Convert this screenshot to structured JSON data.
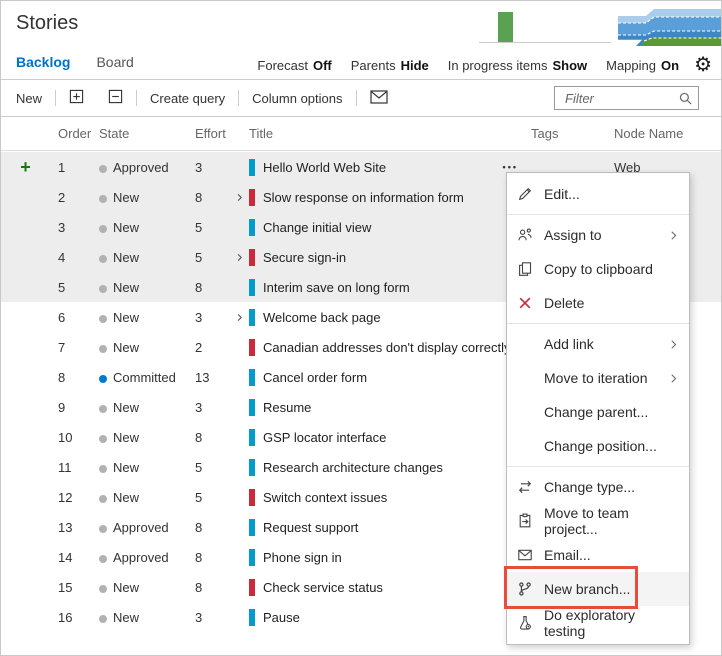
{
  "window": {
    "title": "Stories"
  },
  "tabs": [
    {
      "label": "Backlog",
      "active": true
    },
    {
      "label": "Board",
      "active": false
    }
  ],
  "view_toggles": [
    {
      "label": "Forecast",
      "value": "Off"
    },
    {
      "label": "Parents",
      "value": "Hide"
    },
    {
      "label": "In progress items",
      "value": "Show"
    },
    {
      "label": "Mapping",
      "value": "On"
    }
  ],
  "icons": {
    "gear": "⚙",
    "more_actions": "•••",
    "add_row": "+"
  },
  "toolbar": {
    "new_label": "New",
    "create_query_label": "Create query",
    "column_options_label": "Column options",
    "filter_placeholder": "Filter"
  },
  "table": {
    "columns": [
      "Order",
      "State",
      "Effort",
      "Title",
      "Tags",
      "Node Name"
    ],
    "rows": [
      {
        "order": "1",
        "state": "Approved",
        "state_color": "#b2b2b2",
        "effort": "3",
        "title": "Hello World Web Site",
        "bar_color": "#009ccc",
        "expand": false,
        "selected": true,
        "node_name": "Web",
        "has_add_button": true,
        "has_more_actions": true
      },
      {
        "order": "2",
        "state": "New",
        "state_color": "#b2b2b2",
        "effort": "8",
        "title": "Slow response on information form",
        "bar_color": "#cc293d",
        "expand": true,
        "selected": true,
        "node_name": ""
      },
      {
        "order": "3",
        "state": "New",
        "state_color": "#b2b2b2",
        "effort": "5",
        "title": "Change initial view",
        "bar_color": "#009ccc",
        "expand": false,
        "selected": true,
        "node_name": ""
      },
      {
        "order": "4",
        "state": "New",
        "state_color": "#b2b2b2",
        "effort": "5",
        "title": "Secure sign-in",
        "bar_color": "#cc293d",
        "expand": true,
        "selected": true,
        "node_name": ""
      },
      {
        "order": "5",
        "state": "New",
        "state_color": "#b2b2b2",
        "effort": "8",
        "title": "Interim save on long form",
        "bar_color": "#009ccc",
        "expand": false,
        "selected": true,
        "node_name": ""
      },
      {
        "order": "6",
        "state": "New",
        "state_color": "#b2b2b2",
        "effort": "3",
        "title": "Welcome back page",
        "bar_color": "#009ccc",
        "expand": true,
        "selected": false,
        "node_name": ""
      },
      {
        "order": "7",
        "state": "New",
        "state_color": "#b2b2b2",
        "effort": "2",
        "title": "Canadian addresses don't display correctly",
        "bar_color": "#cc293d",
        "expand": false,
        "selected": false,
        "node_name": ""
      },
      {
        "order": "8",
        "state": "Committed",
        "state_color": "#007acc",
        "effort": "13",
        "title": "Cancel order form",
        "bar_color": "#009ccc",
        "expand": false,
        "selected": false,
        "node_name": ""
      },
      {
        "order": "9",
        "state": "New",
        "state_color": "#b2b2b2",
        "effort": "3",
        "title": "Resume",
        "bar_color": "#009ccc",
        "expand": false,
        "selected": false,
        "node_name": ""
      },
      {
        "order": "10",
        "state": "New",
        "state_color": "#b2b2b2",
        "effort": "8",
        "title": "GSP locator interface",
        "bar_color": "#009ccc",
        "expand": false,
        "selected": false,
        "node_name": ""
      },
      {
        "order": "11",
        "state": "New",
        "state_color": "#b2b2b2",
        "effort": "5",
        "title": "Research architecture changes",
        "bar_color": "#009ccc",
        "expand": false,
        "selected": false,
        "node_name": ""
      },
      {
        "order": "12",
        "state": "New",
        "state_color": "#b2b2b2",
        "effort": "5",
        "title": "Switch context issues",
        "bar_color": "#cc293d",
        "expand": false,
        "selected": false,
        "node_name": ""
      },
      {
        "order": "13",
        "state": "Approved",
        "state_color": "#b2b2b2",
        "effort": "8",
        "title": "Request support",
        "bar_color": "#009ccc",
        "expand": false,
        "selected": false,
        "node_name": ""
      },
      {
        "order": "14",
        "state": "Approved",
        "state_color": "#b2b2b2",
        "effort": "8",
        "title": "Phone sign in",
        "bar_color": "#009ccc",
        "expand": false,
        "selected": false,
        "node_name": ""
      },
      {
        "order": "15",
        "state": "New",
        "state_color": "#b2b2b2",
        "effort": "8",
        "title": "Check service status",
        "bar_color": "#cc293d",
        "expand": false,
        "selected": false,
        "node_name": ""
      },
      {
        "order": "16",
        "state": "New",
        "state_color": "#b2b2b2",
        "effort": "3",
        "title": "Pause",
        "bar_color": "#009ccc",
        "expand": false,
        "selected": false,
        "node_name": ""
      }
    ]
  },
  "context_menu": {
    "items": [
      {
        "label": "Edit...",
        "icon": "pencil-icon",
        "submenu": false,
        "divider_after": true,
        "highlighted": false
      },
      {
        "label": "Assign to",
        "icon": "assign-icon",
        "submenu": true,
        "divider_after": false,
        "highlighted": false
      },
      {
        "label": "Copy to clipboard",
        "icon": "copy-icon",
        "submenu": false,
        "divider_after": false,
        "highlighted": false
      },
      {
        "label": "Delete",
        "icon": "delete-icon",
        "submenu": false,
        "divider_after": true,
        "highlighted": false
      },
      {
        "label": "Add link",
        "icon": "",
        "submenu": true,
        "divider_after": false,
        "highlighted": false
      },
      {
        "label": "Move to iteration",
        "icon": "",
        "submenu": true,
        "divider_after": false,
        "highlighted": false
      },
      {
        "label": "Change parent...",
        "icon": "",
        "submenu": false,
        "divider_after": false,
        "highlighted": false
      },
      {
        "label": "Change position...",
        "icon": "",
        "submenu": false,
        "divider_after": true,
        "highlighted": false
      },
      {
        "label": "Change type...",
        "icon": "change-type-icon",
        "submenu": false,
        "divider_after": false,
        "highlighted": false
      },
      {
        "label": "Move to team project...",
        "icon": "move-project-icon",
        "submenu": false,
        "divider_after": false,
        "highlighted": false
      },
      {
        "label": "Email...",
        "icon": "email-icon",
        "submenu": false,
        "divider_after": false,
        "highlighted": false
      },
      {
        "label": "New branch...",
        "icon": "branch-icon",
        "submenu": false,
        "divider_after": false,
        "highlighted": true
      },
      {
        "label": "Do exploratory testing",
        "icon": "test-flask-icon",
        "submenu": false,
        "divider_after": false,
        "highlighted": false
      }
    ]
  },
  "annotation": {
    "highlight_color": "#e74c3c"
  },
  "colors": {
    "accent_blue": "#0072c6",
    "story_bar": "#009ccc",
    "bug_bar": "#cc293d",
    "committed_dot": "#007acc",
    "new_dot": "#b2b2b2",
    "add_green": "#107c10",
    "selected_row": "#ededed",
    "velocity_green": "#5aa152"
  }
}
